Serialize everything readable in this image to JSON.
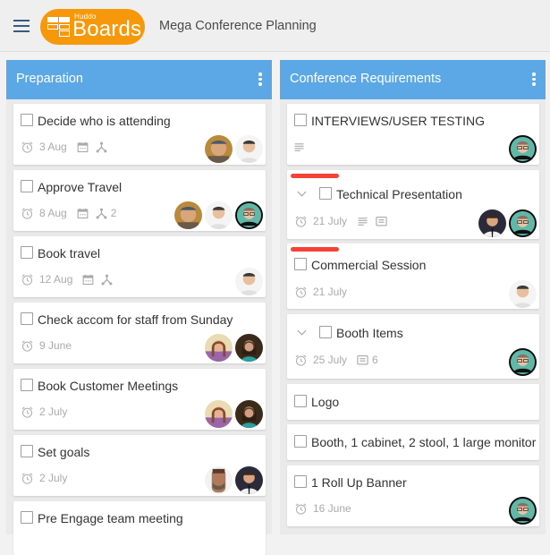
{
  "header": {
    "menu_icon": "hamburger-menu-icon",
    "logo_small": "Huddo",
    "logo_big": "Boards",
    "board_title": "Mega Conference Planning"
  },
  "colors": {
    "accent_orange": "#f7980a",
    "column_header_blue": "#5ca8e6",
    "priority_red": "#f44336",
    "nav_icon": "#3a5a80"
  },
  "columns": [
    {
      "title": "Preparation",
      "cards": [
        {
          "title": "Decide who is attending",
          "due": "3 Aug",
          "icons": [
            "calendar-icon",
            "subtasks-icon"
          ],
          "assignees": [
            "user-a",
            "user-b"
          ]
        },
        {
          "title": "Approve Travel",
          "due": "8 Aug",
          "icons": [
            "calendar-icon",
            "subtasks-icon"
          ],
          "subtask_count": "2",
          "assignees": [
            "user-a",
            "user-b",
            "user-c"
          ]
        },
        {
          "title": "Book travel",
          "due": "12 Aug",
          "icons": [
            "calendar-icon",
            "subtasks-icon"
          ],
          "assignees": [
            "user-b"
          ]
        },
        {
          "title": "Check accom for staff from Sunday",
          "due": "9 June",
          "assignees": [
            "user-d",
            "user-e"
          ]
        },
        {
          "title": "Book Customer Meetings",
          "due": "2 July",
          "assignees": [
            "user-d",
            "user-e"
          ]
        },
        {
          "title": "Set goals",
          "due": "2 July",
          "assignees": [
            "user-f",
            "user-g"
          ]
        },
        {
          "title": "Pre Engage team meeting"
        }
      ]
    },
    {
      "title": "Conference Requirements",
      "cards": [
        {
          "title": "INTERVIEWS/USER TESTING",
          "icons": [
            "description-icon"
          ],
          "assignees": [
            "user-c"
          ]
        },
        {
          "title": "Technical Presentation",
          "priority": "high",
          "expandable": true,
          "due": "21 July",
          "icons": [
            "description-icon",
            "comment-icon"
          ],
          "assignees": [
            "user-g",
            "user-c"
          ]
        },
        {
          "title": "Commercial Session",
          "priority": "high",
          "due": "21 July",
          "assignees": [
            "user-b"
          ]
        },
        {
          "title": "Booth Items",
          "expandable": true,
          "due": "25 July",
          "icons": [
            "comment-icon"
          ],
          "comment_count": "6",
          "assignees": [
            "user-c"
          ]
        },
        {
          "title": "Logo"
        },
        {
          "title": "Booth, 1 cabinet, 2 stool, 1 large monitor"
        },
        {
          "title": "1 Roll Up Banner",
          "due": "16 June",
          "assignees": [
            "user-c"
          ]
        }
      ]
    }
  ]
}
